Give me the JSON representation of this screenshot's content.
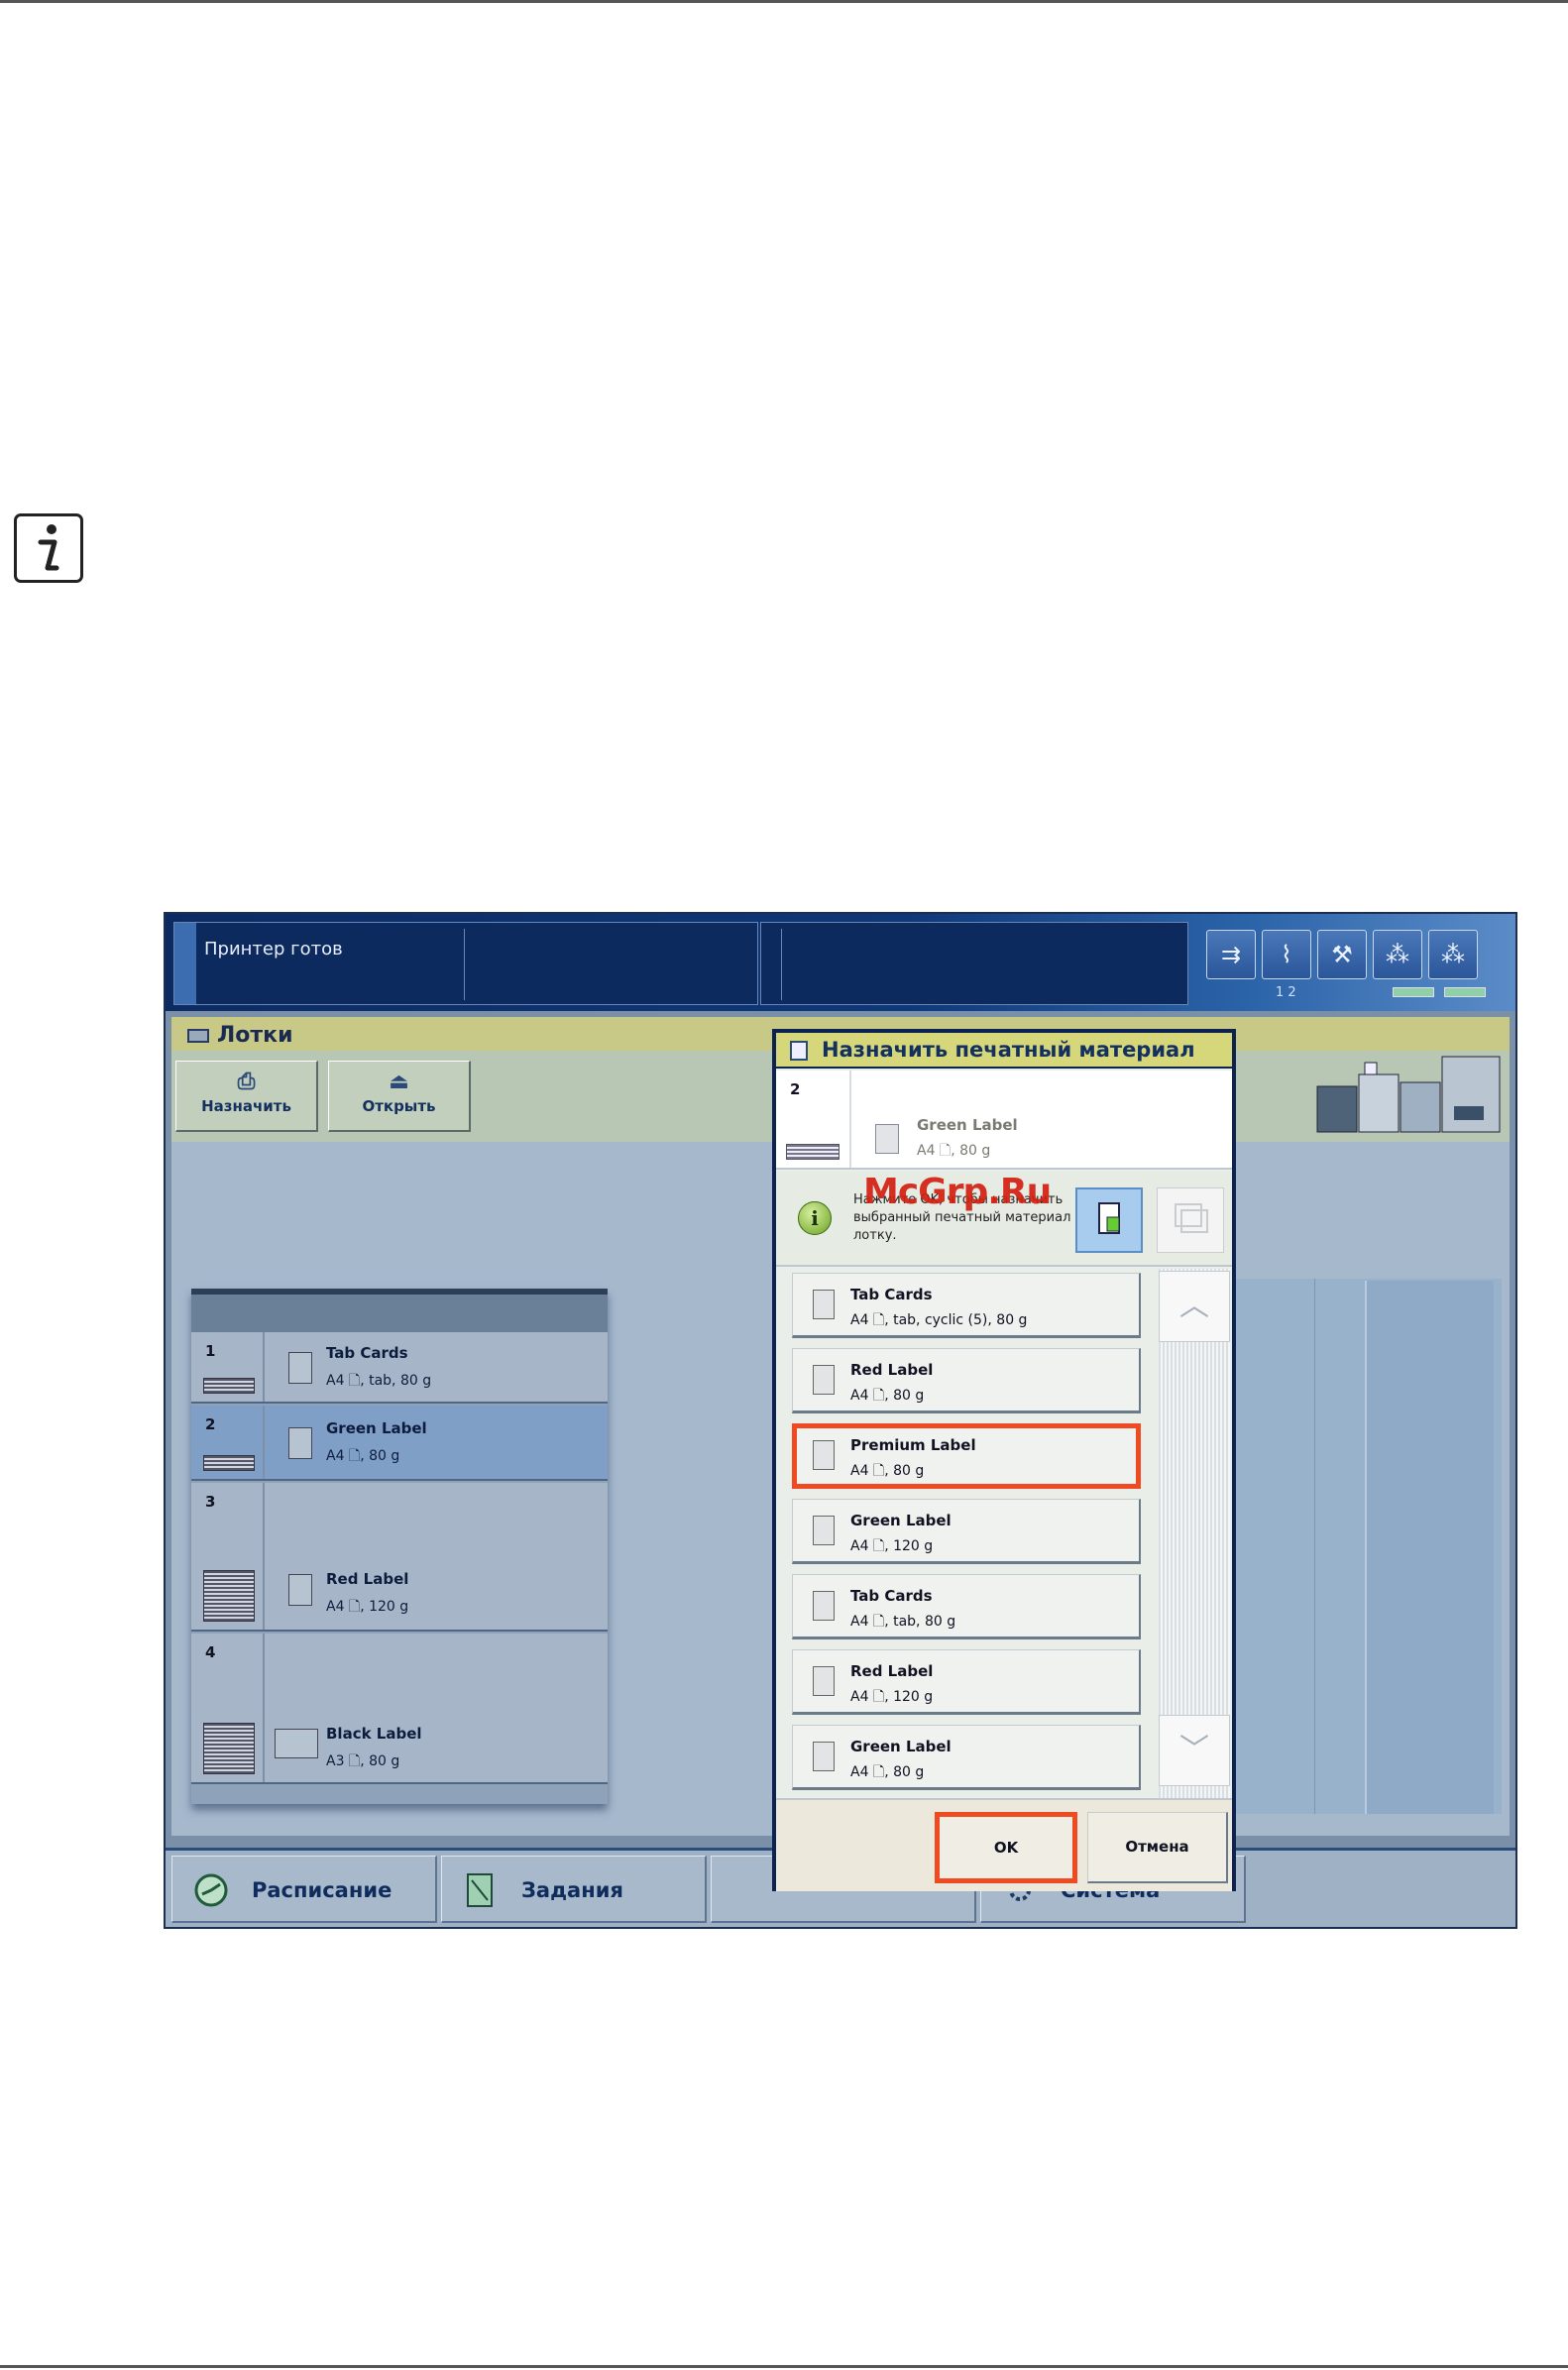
{
  "status": {
    "text": "Принтер готов",
    "tool_numbers": "1  2"
  },
  "trays_panel": {
    "title": "Лотки",
    "assign_label": "Назначить",
    "open_label": "Открыть",
    "trays": [
      {
        "num": "1",
        "name": "Tab Cards",
        "spec": "A4 🗋, tab, 80 g",
        "selected": false
      },
      {
        "num": "2",
        "name": "Green Label",
        "spec": "A4 🗋, 80 g",
        "selected": true
      },
      {
        "num": "3",
        "name": "Red Label",
        "spec": "A4 🗋, 120 g",
        "selected": false
      },
      {
        "num": "4",
        "name": "Black Label",
        "spec": "A3 🗋, 80 g",
        "selected": false
      }
    ]
  },
  "bottom_nav": {
    "schedule": "Расписание",
    "jobs": "Задания",
    "system": "Система"
  },
  "dialog": {
    "title": "Назначить печатный материал",
    "current": {
      "num": "2",
      "name": "Green Label",
      "spec": "A4 🗋, 80 g"
    },
    "info_text": "Нажмите OK, чтобы назначить выбранный печатный материал лотку.",
    "watermark": "McGrp.Ru",
    "media": [
      {
        "name": "Tab Cards",
        "spec": "A4 🗋, tab, cyclic (5), 80 g",
        "highlighted": false
      },
      {
        "name": "Red Label",
        "spec": "A4 🗋, 80 g",
        "highlighted": false
      },
      {
        "name": "Premium Label",
        "spec": "A4 🗋, 80 g",
        "highlighted": true
      },
      {
        "name": "Green Label",
        "spec": "A4 🗋, 120 g",
        "highlighted": false
      },
      {
        "name": "Tab Cards",
        "spec": "A4 🗋, tab, 80 g",
        "highlighted": false
      },
      {
        "name": "Red Label",
        "spec": "A4 🗋, 120 g",
        "highlighted": false
      },
      {
        "name": "Green Label",
        "spec": "A4 🗋, 80 g",
        "highlighted": false
      }
    ],
    "ok_label": "OK",
    "cancel_label": "Отмена"
  },
  "colors": {
    "highlight": "#ef4a22",
    "title_bar": "#d6d67a",
    "status_bar": "#0f3878"
  }
}
